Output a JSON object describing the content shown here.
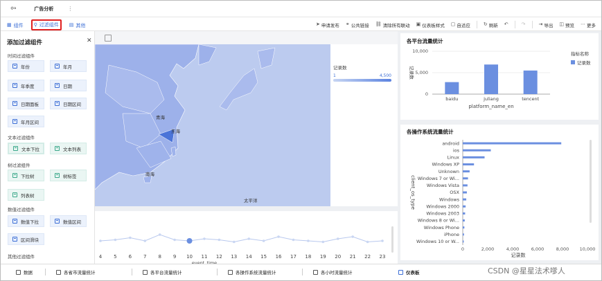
{
  "app": {
    "doc_title": "广告分析",
    "more": "⋮"
  },
  "toolbar": {
    "left": [
      {
        "label": "组件",
        "selected": false
      },
      {
        "label": "过滤组件",
        "selected": true
      },
      {
        "label": "其他",
        "selected": false
      }
    ],
    "right": [
      {
        "label": "申请发布",
        "icon": "send-icon"
      },
      {
        "label": "公共链接",
        "icon": "link-icon"
      },
      {
        "label": "清除所有联动",
        "icon": "unlink-icon"
      },
      {
        "label": "仪表板样式",
        "icon": "palette-icon"
      },
      {
        "label": "自适应",
        "icon": "fit-icon"
      },
      {
        "label": "刷新",
        "icon": "refresh-icon"
      },
      {
        "label": "",
        "icon": "undo-icon"
      },
      {
        "label": "",
        "icon": "redo-icon"
      },
      {
        "label": "导出",
        "icon": "export-icon"
      },
      {
        "label": "预览",
        "icon": "preview-icon"
      },
      {
        "label": "更多",
        "icon": "more-icon"
      }
    ]
  },
  "panel": {
    "title": "添加过滤组件",
    "sections": [
      {
        "title": "时间过滤组件",
        "items": [
          {
            "label": "年份",
            "selected": false
          },
          {
            "label": "年月",
            "selected": false
          },
          {
            "label": "年季度",
            "selected": false
          },
          {
            "label": "日期",
            "selected": false
          },
          {
            "label": "日期面板",
            "selected": false
          },
          {
            "label": "日期区间",
            "selected": false
          },
          {
            "label": "年月区间",
            "selected": false
          }
        ]
      },
      {
        "title": "文本过滤组件",
        "items": [
          {
            "label": "文本下拉",
            "selected": true
          },
          {
            "label": "文本列表",
            "selected": false
          }
        ]
      },
      {
        "title": "树过滤组件",
        "items": [
          {
            "label": "下拉树",
            "selected": false
          },
          {
            "label": "树标签",
            "selected": false
          },
          {
            "label": "列表树",
            "selected": false
          }
        ]
      },
      {
        "title": "数值过滤组件",
        "items": [
          {
            "label": "数值下拉",
            "selected": false
          },
          {
            "label": "数值区间",
            "selected": false
          },
          {
            "label": "区间滑块",
            "selected": false
          }
        ]
      },
      {
        "title": "其他过滤组件",
        "items": []
      }
    ]
  },
  "map": {
    "labels": [
      "青海",
      "东海",
      "南海",
      "太平洋"
    ],
    "legend_title": "记录数",
    "legend_min": "1",
    "legend_max": "4,500"
  },
  "charts": [
    {
      "chart_data": {
        "type": "bar",
        "title": "各平台流量统计",
        "categories": [
          "baidu",
          "juliang",
          "tencent"
        ],
        "series": [
          {
            "name": "记录数",
            "values": [
              2800,
              6900,
              5500
            ]
          }
        ],
        "xlabel": "platform_name_en",
        "ylabel": "记录数",
        "ylim": [
          0,
          10000
        ],
        "yticks": [
          "0",
          "5,000",
          "10,000"
        ],
        "legend_title": "指标名称",
        "legend_position": "top-right",
        "color": "#6b8fe0"
      }
    },
    {
      "chart_data": {
        "type": "bar",
        "orientation": "horizontal",
        "title": "各操作系统流量统计",
        "categories": [
          "android",
          "ios",
          "Linux",
          "Windows XP",
          "Unknown",
          "Windows 7 or Wi...",
          "Windows Vista",
          "OSX",
          "Windows",
          "Windows 2000",
          "Windows 2003",
          "Windows 8 or Wi...",
          "Windows Phone",
          "iPhone",
          "Windows 10 or W..."
        ],
        "values": [
          7900,
          2250,
          1750,
          900,
          550,
          420,
          380,
          330,
          280,
          230,
          190,
          160,
          130,
          100,
          80
        ],
        "xlabel": "记录数",
        "ylabel": "client_os_type",
        "xlim": [
          0,
          10000
        ],
        "xticks": [
          "0",
          "2,000",
          "4,000",
          "6,000",
          "8,000",
          "10,000"
        ],
        "color": "#6b8fe0"
      }
    },
    {
      "chart_data": {
        "type": "line",
        "x": [
          "4",
          "5",
          "6",
          "7",
          "8",
          "9",
          "10",
          "11",
          "12",
          "13",
          "14",
          "15",
          "16",
          "17",
          "18",
          "19",
          "20",
          "21",
          "22",
          "23"
        ],
        "values": [
          0.5,
          0.55,
          0.65,
          0.5,
          0.8,
          0.55,
          0.5,
          0.6,
          0.55,
          0.45,
          0.6,
          0.5,
          0.7,
          0.55,
          0.5,
          0.45,
          0.6,
          0.7,
          0.45,
          0.5
        ],
        "highlight_index": 6,
        "xlabel": "event_time",
        "color": "#b8c8ee"
      }
    }
  ],
  "tabs": [
    {
      "label": "数据"
    },
    {
      "label": "各省市流量统计"
    },
    {
      "label": "各平台流量统计"
    },
    {
      "label": "各操作系统流量统计"
    },
    {
      "label": "各小时流量统计"
    },
    {
      "label": "仪表板"
    }
  ],
  "watermark": "CSDN @星星法术嗲人"
}
